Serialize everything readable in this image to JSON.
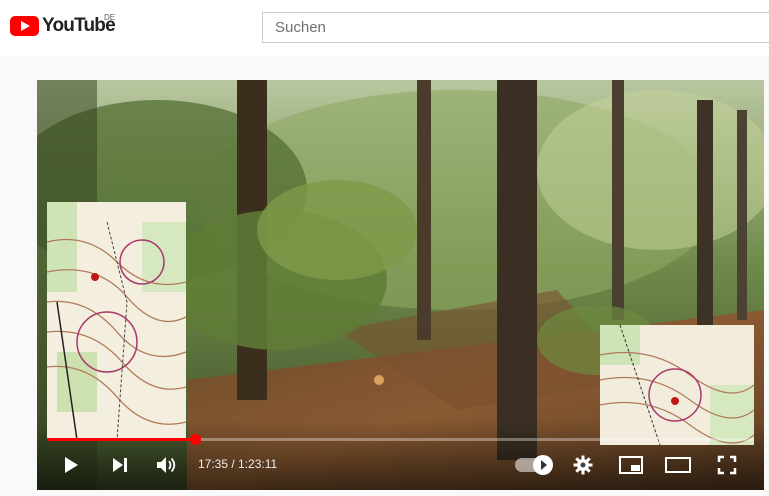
{
  "header": {
    "logo_text": "YouTube",
    "region_code": "DE",
    "search_placeholder": "Suchen"
  },
  "player": {
    "current_time": "17:35",
    "separator": " / ",
    "duration": "1:23:11",
    "progress_fraction": 0.21,
    "progress_color": "#ff0000",
    "icons": [
      "play-icon",
      "next-icon",
      "volume-icon",
      "autoplay-toggle",
      "settings-gear-icon",
      "miniplayer-icon",
      "theater-mode-icon",
      "fullscreen-icon"
    ]
  }
}
